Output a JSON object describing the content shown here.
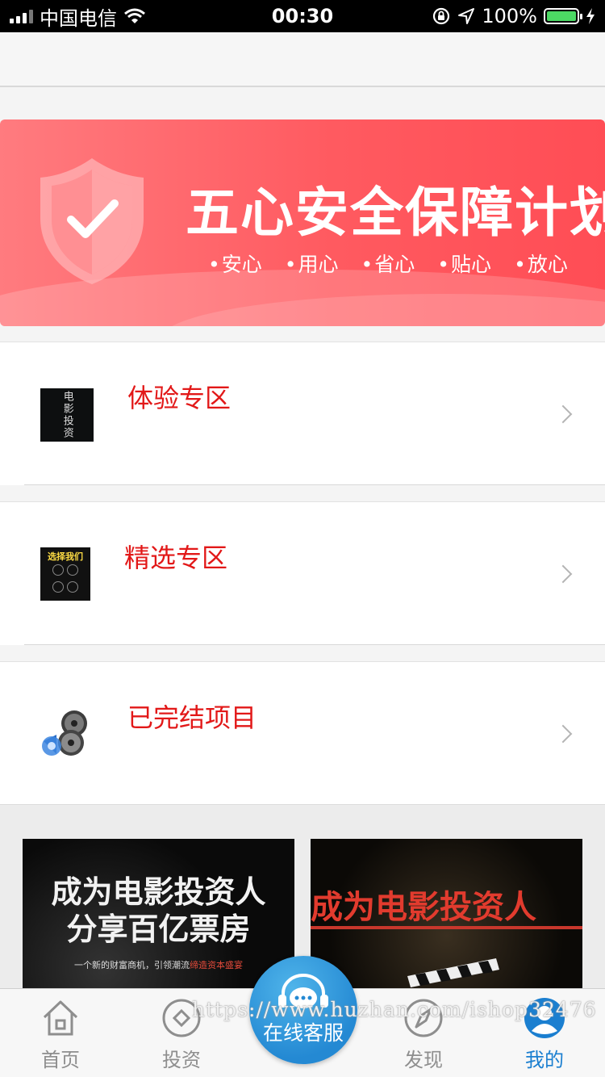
{
  "status_bar": {
    "carrier": "中国电信",
    "time": "00:30",
    "battery_percent": "100%"
  },
  "banner": {
    "title": "五心安全保障计划",
    "tags": [
      "安心",
      "用心",
      "省心",
      "贴心",
      "放心"
    ]
  },
  "list": {
    "items": [
      {
        "label": "体验专区",
        "thumb_text": "电影投资"
      },
      {
        "label": "精选专区",
        "thumb_text": "选择我们"
      },
      {
        "label": "已完结项目"
      }
    ]
  },
  "promos": [
    {
      "title_line1": "成为电影投资人",
      "title_line2": "分享百亿票房",
      "subtitle_pre": "一个新的财富商机，引领潮流",
      "subtitle_highlight": "缔造资本盛宴"
    },
    {
      "title": "成为电影投资人"
    }
  ],
  "tab_bar": {
    "tabs": [
      {
        "label": "首页",
        "icon": "home-icon"
      },
      {
        "label": "投资",
        "icon": "diamond-icon"
      },
      {
        "label": "发现",
        "icon": "compass-icon"
      },
      {
        "label": "我的",
        "icon": "user-icon"
      }
    ],
    "active_tab": "我的",
    "service_label": "在线客服"
  },
  "watermark": "https://www.huzhan.com/ishop32476",
  "colors": {
    "accent": "#e21818",
    "banner": "#ff5a60",
    "tab_active": "#1b7fd0",
    "service": "#2489d3"
  }
}
